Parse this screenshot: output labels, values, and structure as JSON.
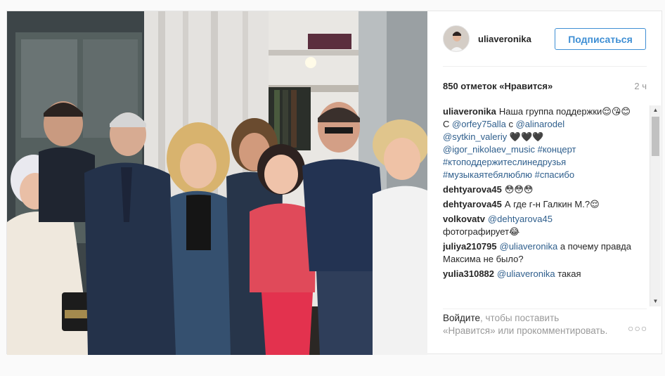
{
  "post": {
    "username": "uliaveronika",
    "follow_button": "Подписаться",
    "likes": "850 отметок «Нравится»",
    "time": "2 ч",
    "caption": {
      "username": "uliaveronika",
      "text_1": "Наша группа поддержки😌😘😊",
      "text_2": "С",
      "mention_1": "@orfey75alla",
      "text_3": "с",
      "mention_2": "@alinarodel",
      "mention_3": "@sytkin_valeriy",
      "hearts": "🖤🖤🖤",
      "mention_4": "@igor_nikolaev_music",
      "tag_1": "#концерт",
      "tag_2": "#ктоподдержитеслинедрузья",
      "tag_3": "#музыкаятебялюблю",
      "tag_4": "#спасибо"
    },
    "comments": [
      {
        "user": "dehtyarova45",
        "text": "😳😳😳"
      },
      {
        "user": "dehtyarova45",
        "text": "А где г-н Галкин М.?😌"
      },
      {
        "user": "volkovatv",
        "mention": "@dehtyarova45",
        "text": "фотографирует😂"
      },
      {
        "user": "juliya210795",
        "mention": "@uliaveronika",
        "text": "а почему правда Максима не было?"
      },
      {
        "user": "yulia310882",
        "mention": "@uliaveronika",
        "text": "такая"
      }
    ],
    "login_prompt": {
      "link": "Войдите",
      "text": ", чтобы поставить «Нравится» или прокомментировать."
    },
    "more_options": "○○○"
  },
  "scrollbar": {
    "up": "▲",
    "down": "▼"
  },
  "colors": {
    "follow_blue": "#3f8fd4",
    "link_blue": "#2e5e8c",
    "muted_gray": "#999999",
    "text_dark": "#262626"
  }
}
